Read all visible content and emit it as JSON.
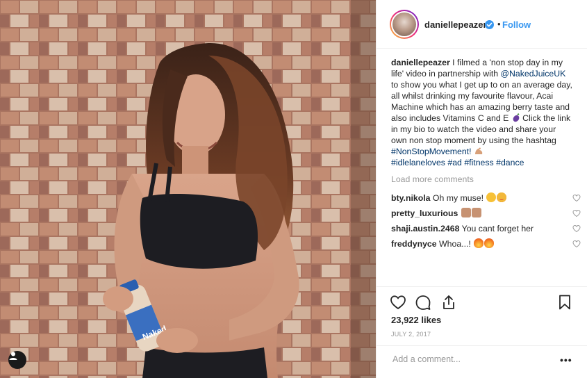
{
  "post": {
    "username": "daniellepeazer",
    "follow_label": "Follow",
    "separator": "•",
    "caption": {
      "part1": " I filmed a 'non stop day in my life' video in partnership with ",
      "mention": "@NakedJuiceUK",
      "part2": " to show you what I get up to on an average day, all whilst drinking my favourite flavour, Acai Machine which has an amazing berry taste and also includes Vitamins C and E ",
      "part3": " Click the link in my bio to watch the video and share your own non stop moment by using the hashtag ",
      "hashtag1": "#NonStopMovement!",
      "hashtag2": "#idlelaneloves",
      "hashtag3": "#ad",
      "hashtag4": "#fitness",
      "hashtag5": "#dance"
    },
    "load_more": "Load more comments",
    "comments": [
      {
        "user": "bty.nikola",
        "text": "Oh my muse!"
      },
      {
        "user": "pretty_luxurious",
        "text": ""
      },
      {
        "user": "shaji.austin.2468",
        "text": "You cant forget her"
      },
      {
        "user": "freddynyce",
        "text": "Whoa...!"
      }
    ],
    "likes": "23,922 likes",
    "date": "JULY 2, 2017",
    "add_comment_placeholder": "Add a comment...",
    "more_label": "•••"
  },
  "product": {
    "brand": "Naked"
  },
  "colors": {
    "link": "#003569",
    "follow": "#3897f0",
    "verified": "#3897f0",
    "muted": "#999999"
  }
}
